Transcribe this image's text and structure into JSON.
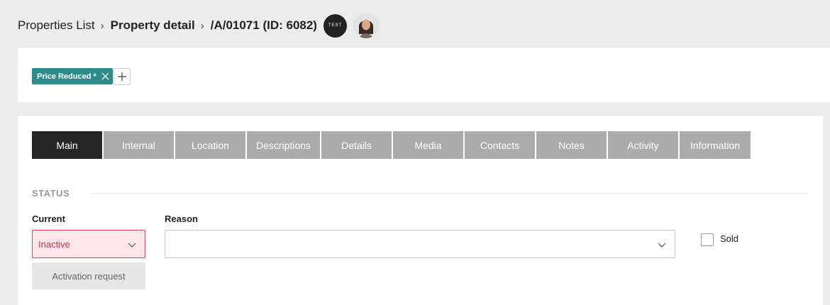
{
  "breadcrumb": {
    "root": "Properties List",
    "detail": "Property detail",
    "reference": "/A/01071 (ID: 6082)",
    "test_badge": "TEST"
  },
  "tags": {
    "items": [
      {
        "label": "Price Reduced *"
      }
    ]
  },
  "tabs": [
    {
      "label": "Main",
      "active": true
    },
    {
      "label": "Internal"
    },
    {
      "label": "Location"
    },
    {
      "label": "Descriptions"
    },
    {
      "label": "Details"
    },
    {
      "label": "Media"
    },
    {
      "label": "Contacts"
    },
    {
      "label": "Notes"
    },
    {
      "label": "Activity"
    },
    {
      "label": "Information"
    }
  ],
  "status": {
    "section_title": "STATUS",
    "current_label": "Current",
    "current_value": "Inactive",
    "reason_label": "Reason",
    "reason_value": "",
    "activation_button": "Activation request",
    "sold_label": "Sold",
    "sold_checked": false
  },
  "colors": {
    "tag": "#2e8b8b",
    "tab_active": "#262626",
    "tab_inactive": "#ababab",
    "status_error": "#d32f4a"
  }
}
